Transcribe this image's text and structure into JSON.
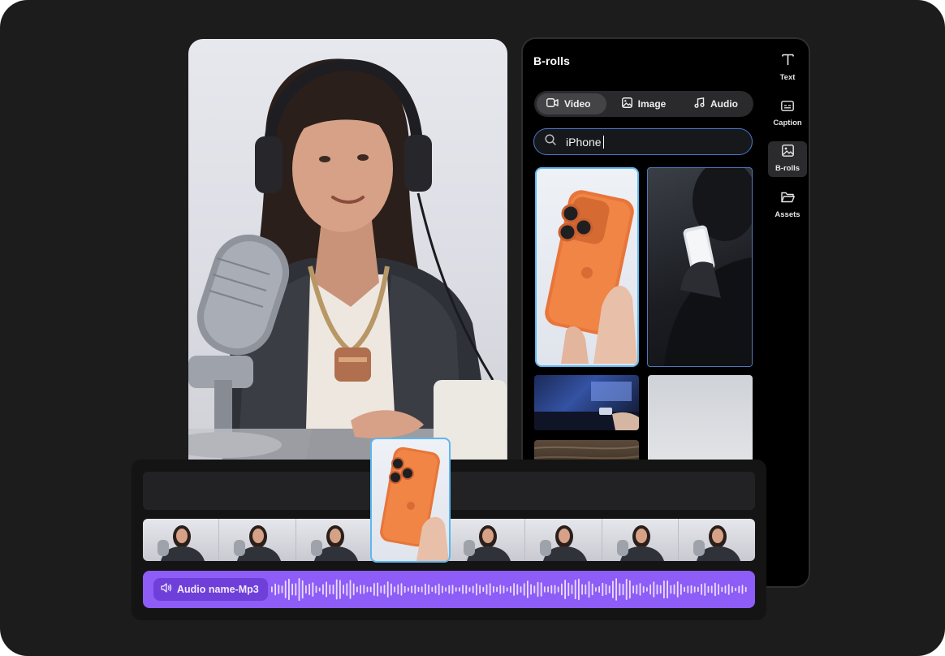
{
  "colors": {
    "frame_bg": "#1c1c1c",
    "panel_bg": "#000000",
    "accent_blue": "#5db7f0",
    "audio_purple": "#8e5cf6",
    "phone_orange": "#e8753a"
  },
  "panel": {
    "title": "B-rolls",
    "tabs": [
      {
        "label": "Video",
        "icon": "video-camera-icon",
        "active": true
      },
      {
        "label": "Image",
        "icon": "image-icon",
        "active": false
      },
      {
        "label": "Audio",
        "icon": "music-note-icon",
        "active": false
      }
    ],
    "search": {
      "value": "iPhone",
      "icon": "search-icon"
    },
    "results": [
      {
        "name": "orange-iphone-in-hand",
        "selected": true
      },
      {
        "name": "person-holding-phone-dark",
        "selected": false
      },
      {
        "name": "desk-setup-phone",
        "selected": false
      },
      {
        "name": "blank-white-wall",
        "selected": false
      },
      {
        "name": "wooden-surface",
        "selected": false
      }
    ]
  },
  "rail": [
    {
      "label": "Text",
      "icon": "text-icon",
      "active": false
    },
    {
      "label": "Caption",
      "icon": "caption-icon",
      "active": false
    },
    {
      "label": "B-rolls",
      "icon": "image-icon",
      "active": true
    },
    {
      "label": "Assets",
      "icon": "folder-icon",
      "active": false
    }
  ],
  "timeline": {
    "audio": {
      "label": "Audio name-Mp3",
      "icon": "speaker-icon"
    },
    "filmstrip_frames": 8
  }
}
